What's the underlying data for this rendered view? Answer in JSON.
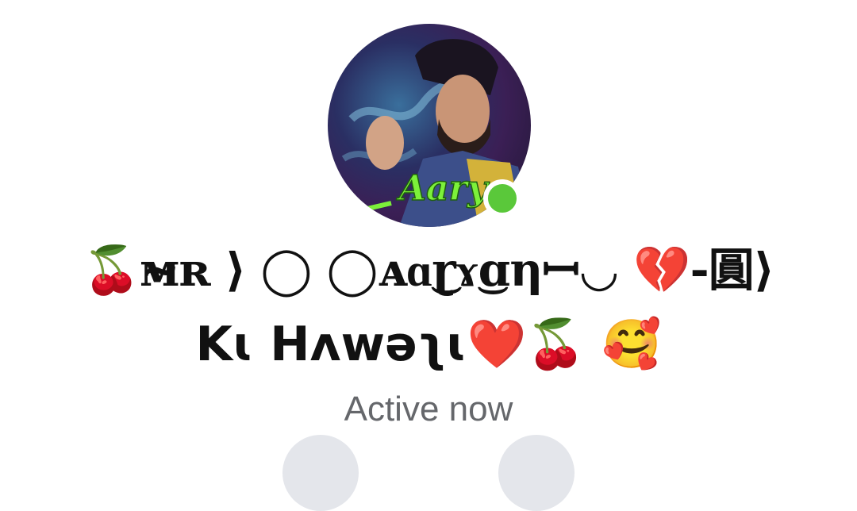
{
  "profile": {
    "name_line_1": "🍒ᴍ̴ʀ ⟩ ◯ ◯ᴀɑ͜ɽɤ͜ɑηꟷ◡ 💔-圓⟩",
    "name_line_2": "Kɩ Hʌwəʅɩ❤️🍒 🥰",
    "watermark": "Aarya",
    "status": "Active now",
    "online_color": "#5ac83a"
  },
  "actions": [
    {
      "icon": "phone-icon"
    },
    {
      "icon": "video-icon"
    }
  ]
}
